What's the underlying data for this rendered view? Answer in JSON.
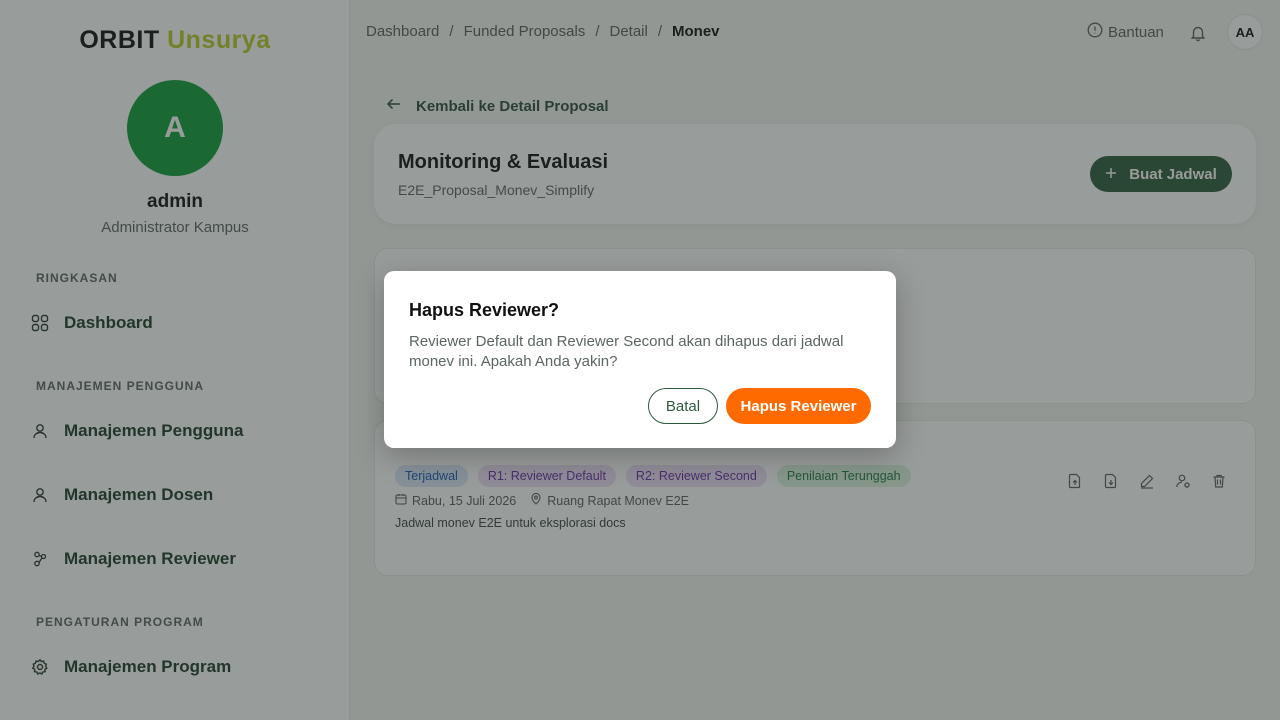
{
  "brand": {
    "part1": "ORBIT",
    "part2": "Unsurya"
  },
  "user": {
    "initial": "A",
    "name": "admin",
    "role": "Administrator Kampus",
    "short": "AA"
  },
  "sidebar": {
    "sections": [
      {
        "label": "RINGKASAN"
      },
      {
        "label": "MANAJEMEN PENGGUNA"
      },
      {
        "label": "PENGATURAN PROGRAM"
      }
    ],
    "items": [
      {
        "label": "Dashboard",
        "icon": "grid-icon"
      },
      {
        "label": "Manajemen Pengguna",
        "icon": "user-icon"
      },
      {
        "label": "Manajemen Dosen",
        "icon": "user-icon"
      },
      {
        "label": "Manajemen Reviewer",
        "icon": "users-network-icon"
      },
      {
        "label": "Manajemen Program",
        "icon": "gear-icon"
      }
    ]
  },
  "breadcrumb": [
    "Dashboard",
    "Funded Proposals",
    "Detail",
    "Monev"
  ],
  "topbar": {
    "help": "Bantuan"
  },
  "page": {
    "back": "Kembali ke Detail Proposal",
    "title": "Monitoring & Evaluasi",
    "subtitle": "E2E_Proposal_Monev_Simplify",
    "create_button": "Buat Jadwal"
  },
  "schedule": {
    "badges": [
      "Terjadwal",
      "R1: Reviewer Default",
      "R2: Reviewer Second",
      "Penilaian Terunggah"
    ],
    "date": "Rabu, 15 Juli 2026",
    "location": "Ruang Rapat Monev E2E",
    "description": "Jadwal monev E2E untuk eksplorasi docs"
  },
  "modal": {
    "title": "Hapus Reviewer?",
    "text": "Reviewer Default dan Reviewer Second akan dihapus dari jadwal monev ini. Apakah Anda yakin?",
    "cancel": "Batal",
    "confirm": "Hapus Reviewer"
  },
  "colors": {
    "primary": "#2d5a3e",
    "danger": "#ff6a00",
    "avatar": "#0f9d3a",
    "brand_accent": "#b6cc2a"
  }
}
